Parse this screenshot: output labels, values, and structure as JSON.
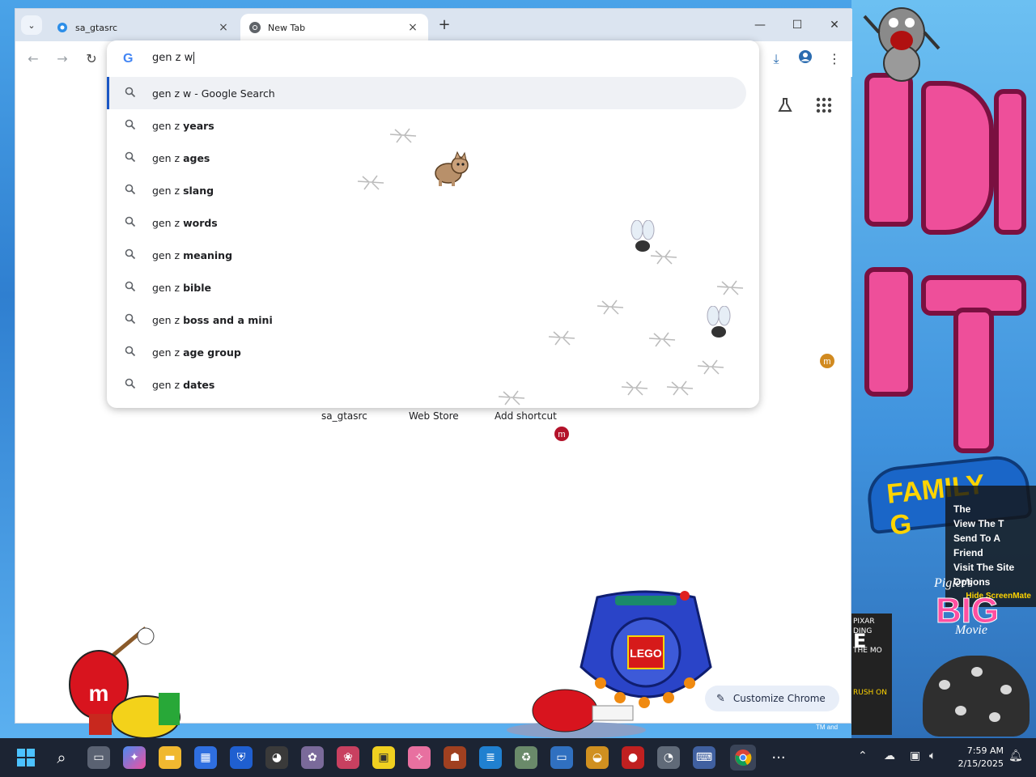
{
  "browser": {
    "tabs": [
      {
        "title": "sa_gtasrc",
        "active": false
      },
      {
        "title": "New Tab",
        "active": true
      }
    ],
    "new_tab_glyph": "+",
    "window_controls": {
      "minimize": "—",
      "maximize": "☐",
      "close": "✕"
    }
  },
  "omnibox": {
    "logo": "G",
    "query": "gen z w",
    "suggestions": [
      {
        "prefix": "gen z w - Google Search",
        "bold": ""
      },
      {
        "prefix": "gen z ",
        "bold": "years"
      },
      {
        "prefix": "gen z ",
        "bold": "ages"
      },
      {
        "prefix": "gen z ",
        "bold": "slang"
      },
      {
        "prefix": "gen z ",
        "bold": "words"
      },
      {
        "prefix": "gen z ",
        "bold": "meaning"
      },
      {
        "prefix": "gen z ",
        "bold": "bible"
      },
      {
        "prefix": "gen z ",
        "bold": "boss and a mini"
      },
      {
        "prefix": "gen z ",
        "bold": "age group"
      },
      {
        "prefix": "gen z ",
        "bold": "dates"
      }
    ]
  },
  "ntp": {
    "shortcuts": [
      "sa_gtasrc",
      "Web Store",
      "Add shortcut"
    ],
    "customize_label": "Customize Chrome"
  },
  "wallpaper": {
    "family_logo": "FAMILY G",
    "promo_lines": [
      "The",
      "View The T",
      "Send To A Friend",
      "Visit The Site",
      "Options"
    ],
    "promo_small": "Hide ScreenMate",
    "piglet_title": "Piglet's",
    "piglet_big": "BIG",
    "piglet_movie": "Movie",
    "pixar_lines": [
      "PIXAR",
      "DING",
      "E",
      "THE MO"
    ],
    "pixar_bottom": "RUSH ON",
    "tm_text": "TM and",
    "lego_label": "LEGO",
    "mm_letter": "m"
  },
  "taskbar": {
    "time": "7:59 AM",
    "date": "2/15/2025"
  },
  "colors": {
    "accent": "#1a56c4",
    "tabstrip": "#dbe4f0",
    "taskbar": "#1c2433"
  }
}
